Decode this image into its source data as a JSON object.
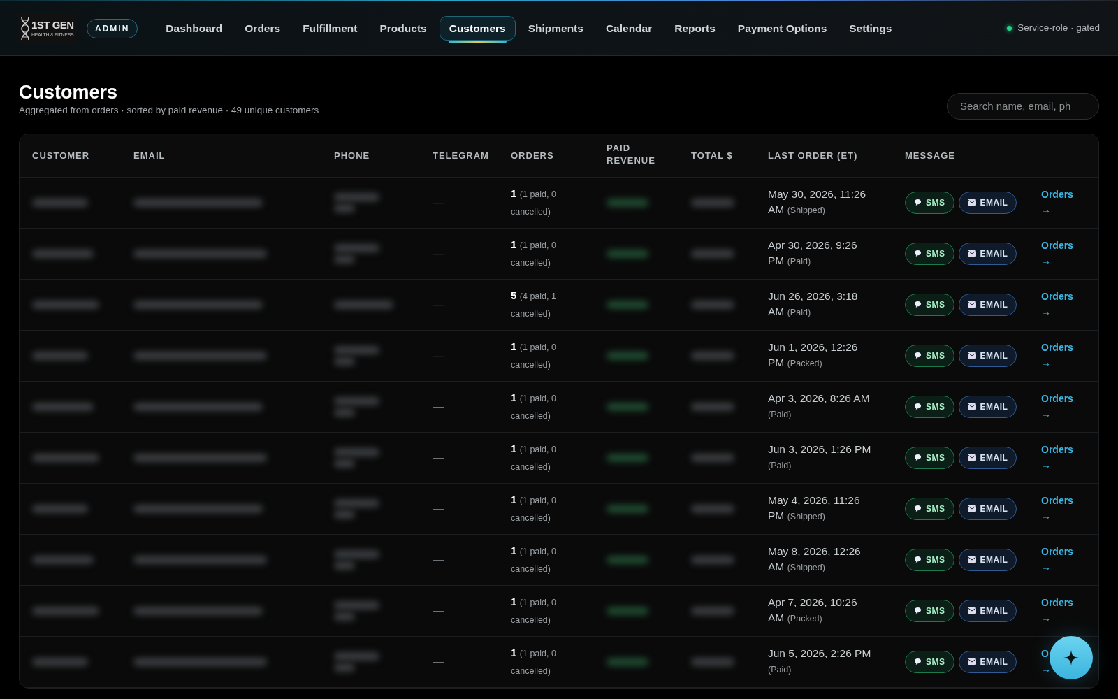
{
  "logo": {
    "title": "1ST GEN",
    "subtitle": "HEALTH & FITNESS"
  },
  "badge": "ADMIN",
  "nav": [
    {
      "label": "Dashboard",
      "selected": false
    },
    {
      "label": "Orders",
      "selected": false
    },
    {
      "label": "Fulfillment",
      "selected": false
    },
    {
      "label": "Products",
      "selected": false
    },
    {
      "label": "Customers",
      "selected": true
    },
    {
      "label": "Shipments",
      "selected": false
    },
    {
      "label": "Calendar",
      "selected": false
    },
    {
      "label": "Reports",
      "selected": false
    },
    {
      "label": "Payment Options",
      "selected": false
    },
    {
      "label": "Settings",
      "selected": false
    }
  ],
  "status": "Service-role · gated",
  "page": {
    "title": "Customers",
    "subtitle": "Aggregated from orders · sorted by paid revenue · 49 unique customers"
  },
  "search": {
    "placeholder": "Search name, email, ph"
  },
  "table": {
    "columns": [
      "CUSTOMER",
      "EMAIL",
      "PHONE",
      "TELEGRAM",
      "ORDERS",
      "PAID REVENUE",
      "TOTAL $",
      "LAST ORDER (ET)",
      "MESSAGE"
    ],
    "rows": [
      {
        "telegram": "—",
        "orders": "1",
        "orders_detail": "(1 paid, 0 cancelled)",
        "last_order": "May 30, 2026, 11:26 AM",
        "last_status": "(Shipped)",
        "sms": "SMS",
        "email": "EMAIL",
        "link": "Orders",
        "arrow": "→"
      },
      {
        "telegram": "—",
        "orders": "1",
        "orders_detail": "(1 paid, 0 cancelled)",
        "last_order": "Apr 30, 2026, 9:26 PM",
        "last_status": "(Paid)",
        "sms": "SMS",
        "email": "EMAIL",
        "link": "Orders",
        "arrow": "→"
      },
      {
        "telegram": "—",
        "orders": "5",
        "orders_detail": "(4 paid, 1 cancelled)",
        "last_order": "Jun 26, 2026, 3:18 AM",
        "last_status": "(Paid)",
        "sms": "SMS",
        "email": "EMAIL",
        "link": "Orders",
        "arrow": "→"
      },
      {
        "telegram": "—",
        "orders": "1",
        "orders_detail": "(1 paid, 0 cancelled)",
        "last_order": "Jun 1, 2026, 12:26 PM",
        "last_status": "(Packed)",
        "sms": "SMS",
        "email": "EMAIL",
        "link": "Orders",
        "arrow": "→"
      },
      {
        "telegram": "—",
        "orders": "1",
        "orders_detail": "(1 paid, 0 cancelled)",
        "last_order": "Apr 3, 2026, 8:26 AM",
        "last_status": "(Paid)",
        "sms": "SMS",
        "email": "EMAIL",
        "link": "Orders",
        "arrow": "→"
      },
      {
        "telegram": "—",
        "orders": "1",
        "orders_detail": "(1 paid, 0 cancelled)",
        "last_order": "Jun 3, 2026, 1:26 PM",
        "last_status": "(Paid)",
        "sms": "SMS",
        "email": "EMAIL",
        "link": "Orders",
        "arrow": "→"
      },
      {
        "telegram": "—",
        "orders": "1",
        "orders_detail": "(1 paid, 0 cancelled)",
        "last_order": "May 4, 2026, 11:26 PM",
        "last_status": "(Shipped)",
        "sms": "SMS",
        "email": "EMAIL",
        "link": "Orders",
        "arrow": "→"
      },
      {
        "telegram": "—",
        "orders": "1",
        "orders_detail": "(1 paid, 0 cancelled)",
        "last_order": "May 8, 2026, 12:26 AM",
        "last_status": "(Shipped)",
        "sms": "SMS",
        "email": "EMAIL",
        "link": "Orders",
        "arrow": "→"
      },
      {
        "telegram": "—",
        "orders": "1",
        "orders_detail": "(1 paid, 0 cancelled)",
        "last_order": "Apr 7, 2026, 10:26 AM",
        "last_status": "(Packed)",
        "sms": "SMS",
        "email": "EMAIL",
        "link": "Orders",
        "arrow": "→"
      },
      {
        "telegram": "—",
        "orders": "1",
        "orders_detail": "(1 paid, 0 cancelled)",
        "last_order": "Jun 5, 2026, 2:26 PM",
        "last_status": "(Paid)",
        "sms": "SMS",
        "email": "EMAIL",
        "link": "O",
        "arrow": "→"
      }
    ]
  }
}
